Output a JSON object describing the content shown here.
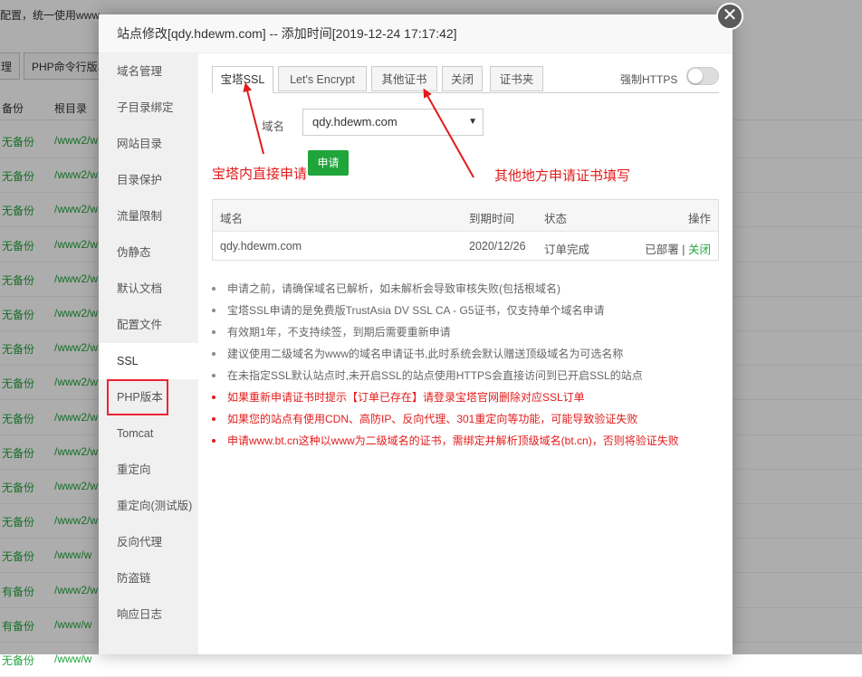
{
  "background": {
    "top_text": "配置，统一使用www...",
    "buttons": [
      "理",
      "PHP命令行版本"
    ],
    "headers": [
      "备份",
      "根目录"
    ],
    "rows": [
      {
        "backup": "无备份",
        "root": "/www2/w"
      },
      {
        "backup": "无备份",
        "root": "/www2/w"
      },
      {
        "backup": "无备份",
        "root": "/www2/w"
      },
      {
        "backup": "无备份",
        "root": "/www2/w"
      },
      {
        "backup": "无备份",
        "root": "/www2/w"
      },
      {
        "backup": "无备份",
        "root": "/www2/w"
      },
      {
        "backup": "无备份",
        "root": "/www2/w"
      },
      {
        "backup": "无备份",
        "root": "/www2/w"
      },
      {
        "backup": "无备份",
        "root": "/www2/w"
      },
      {
        "backup": "无备份",
        "root": "/www2/w"
      },
      {
        "backup": "无备份",
        "root": "/www2/w"
      },
      {
        "backup": "无备份",
        "root": "/www2/w"
      },
      {
        "backup": "无备份",
        "root": "/www/w"
      },
      {
        "backup": "有备份",
        "root": "/www2/w"
      },
      {
        "backup": "有备份",
        "root": "/www/w"
      },
      {
        "backup": "无备份",
        "root": "/www/w"
      }
    ]
  },
  "modal": {
    "title": "站点修改[qdy.hdewm.com] -- 添加时间[2019-12-24 17:17:42]",
    "close_glyph": "✕",
    "sidebar": [
      "域名管理",
      "子目录绑定",
      "网站目录",
      "目录保护",
      "流量限制",
      "伪静态",
      "默认文档",
      "配置文件",
      "SSL",
      "PHP版本",
      "Tomcat",
      "重定向",
      "重定向(测试版)",
      "反向代理",
      "防盗链",
      "响应日志"
    ],
    "active_sidebar": "SSL",
    "tabs": [
      "宝塔SSL",
      "Let's Encrypt",
      "其他证书",
      "关闭",
      "证书夹"
    ],
    "force_https_label": "强制HTTPS",
    "force_https_on": false,
    "domain_label": "域名",
    "domain_value": "qdy.hdewm.com",
    "apply_button": "申请",
    "table": {
      "headers": {
        "domain": "域名",
        "expire": "到期时间",
        "status": "状态",
        "action": "操作"
      },
      "row": {
        "domain": "qdy.hdewm.com",
        "expire": "2020/12/26",
        "status": "订单完成",
        "deployed": "已部署",
        "sep": " | ",
        "close": "关闭"
      }
    },
    "tips": [
      {
        "text": "申请之前，请确保域名已解析，如未解析会导致审核失败(包括根域名)",
        "red": false
      },
      {
        "text": "宝塔SSL申请的是免费版TrustAsia DV SSL CA - G5证书，仅支持单个域名申请",
        "red": false
      },
      {
        "text": "有效期1年，不支持续签，到期后需要重新申请",
        "red": false
      },
      {
        "text": "建议使用二级域名为www的域名申请证书,此时系统会默认赠送顶级域名为可选名称",
        "red": false
      },
      {
        "text": "在未指定SSL默认站点时,未开启SSL的站点使用HTTPS会直接访问到已开启SSL的站点",
        "red": false
      },
      {
        "text": "如果重新申请证书时提示【订单已存在】请登录宝塔官网删除对应SSL订单",
        "red": true
      },
      {
        "text": "如果您的站点有使用CDN、高防IP、反向代理、301重定向等功能，可能导致验证失败",
        "red": true
      },
      {
        "text": "申请www.bt.cn这种以www为二级域名的证书，需绑定并解析顶级域名(bt.cn)，否则将验证失败",
        "red": true
      }
    ]
  },
  "annotations": {
    "left": "宝塔内直接申请",
    "right": "其他地方申请证书填写",
    "color": "#e31b1b"
  }
}
